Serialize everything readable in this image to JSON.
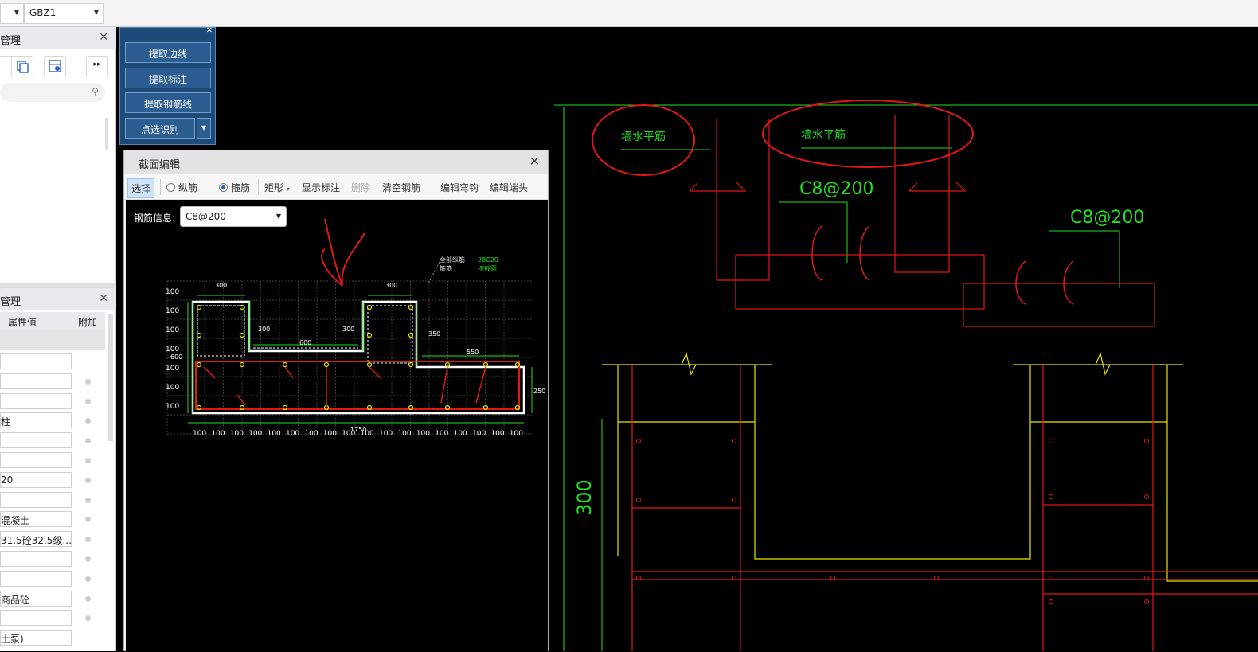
{
  "topbar": {
    "combo1_value": "",
    "combo2_value": "GBZ1"
  },
  "panel1": {
    "title": "管理",
    "close": "✕",
    "expand": "▸▸"
  },
  "panel2": {
    "title": "管理",
    "close": "✕",
    "col_value": "属性值",
    "col_extra": "附加"
  },
  "props": [
    "",
    "",
    "",
    "柱",
    "",
    "",
    "20",
    "",
    "混凝土",
    "31.5砼32.5级...",
    "",
    "",
    "商品砼",
    "",
    "土泵)"
  ],
  "palette": {
    "close": "✕",
    "buttons": [
      "提取边线",
      "提取标注",
      "提取钢筋线",
      "点选识别"
    ],
    "dropdown": "▾"
  },
  "dialog": {
    "title": "截面编辑",
    "close": "✕",
    "tools": {
      "select": "选择",
      "longitudinal": "纵筋",
      "stirrup": "箍筋",
      "rect": "矩形",
      "rect_arrow": "▾",
      "show_dim": "显示标注",
      "delete": "删除",
      "clear": "清空钢筋",
      "edit_hook": "编辑弯钩",
      "edit_end": "编辑端头"
    },
    "rebar_label": "钢筋信息:",
    "rebar_value": "C8@200",
    "section": {
      "legend1": "全部纵筋",
      "legend2": "箍筋",
      "legend1_val": "28C20",
      "legend2_val": "按截面",
      "dims_top": [
        "300",
        "300"
      ],
      "dims_mid": [
        "300",
        "300",
        "600",
        "350",
        "550",
        "600",
        "250"
      ],
      "left_ticks": [
        "100",
        "100",
        "100",
        "100",
        "100",
        "100",
        "100"
      ],
      "bottom_ticks": [
        "100",
        "100",
        "100",
        "100",
        "100",
        "100",
        "100",
        "100",
        "100",
        "100",
        "100",
        "100",
        "100",
        "100",
        "100",
        "100",
        "100",
        "100"
      ],
      "total": "1750"
    }
  },
  "cad": {
    "label1": "墙水平筋",
    "label2": "墙水平筋",
    "stirrup1": "C8@200",
    "stirrup2": "C8@200",
    "dim": "300"
  },
  "colors": {
    "green": "#22dd22",
    "red": "#e01818",
    "yellow": "#e6e600",
    "palette": "#1c4b79"
  }
}
